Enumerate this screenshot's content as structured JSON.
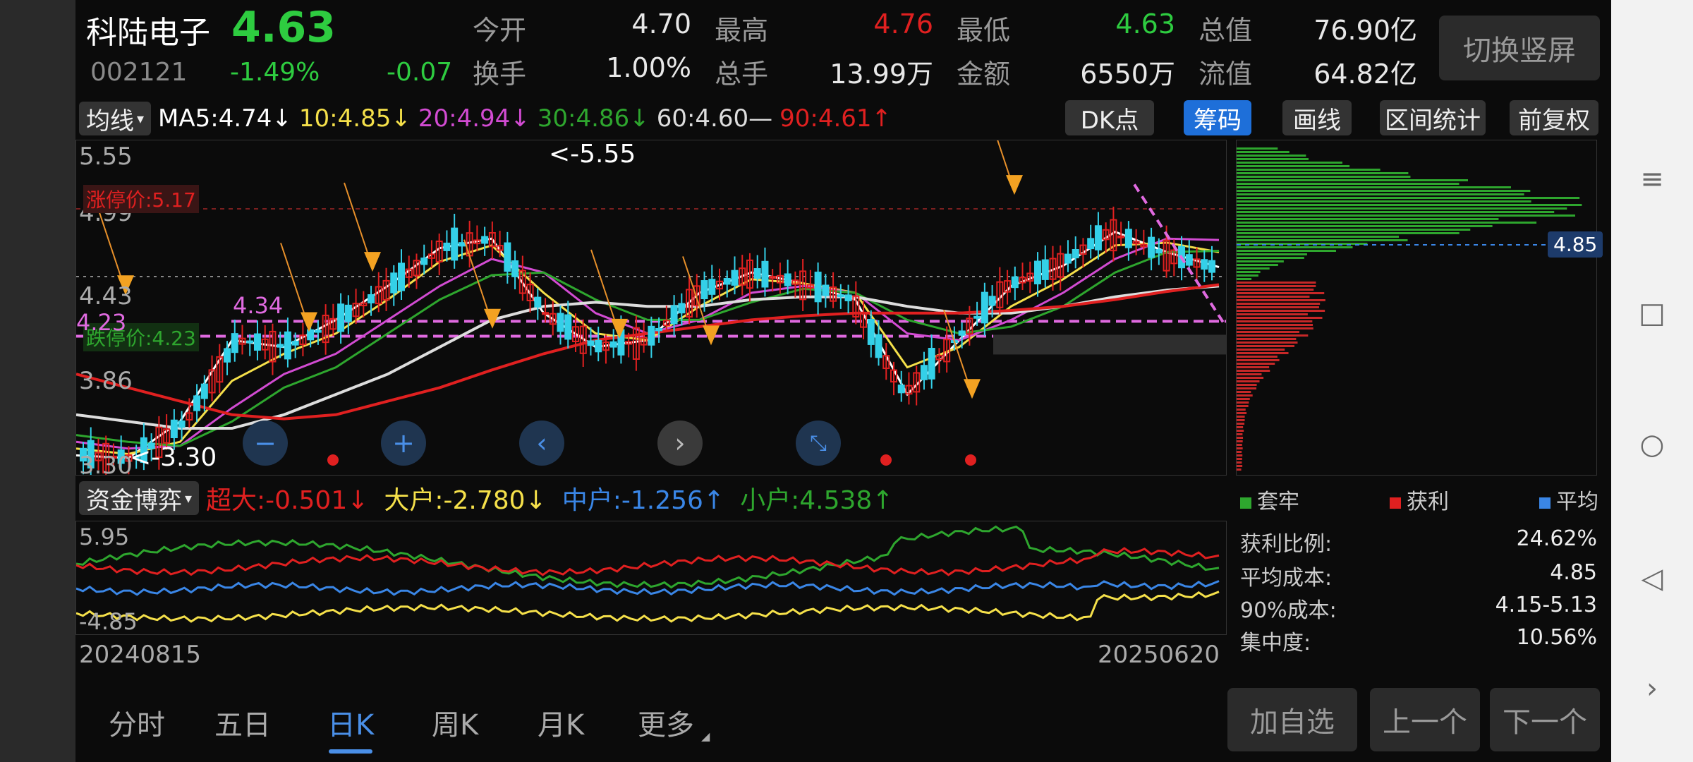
{
  "header": {
    "name": "科陆电子",
    "price": "4.63",
    "code": "002121",
    "pct": "-1.49%",
    "change": "-0.07",
    "quotes": [
      {
        "label": "今开",
        "value": "4.70",
        "color": "#e8e8e8"
      },
      {
        "label": "最高",
        "value": "4.76",
        "color": "#e02020"
      },
      {
        "label": "最低",
        "value": "4.63",
        "color": "#2ecc40"
      },
      {
        "label": "总值",
        "value": "76.90亿",
        "color": "#e8e8e8"
      },
      {
        "label": "换手",
        "value": "1.00%",
        "color": "#e8e8e8"
      },
      {
        "label": "总手",
        "value": "13.99万",
        "color": "#e8e8e8"
      },
      {
        "label": "金额",
        "value": "6550万",
        "color": "#e8e8e8"
      },
      {
        "label": "流值",
        "value": "64.82亿",
        "color": "#e8e8e8"
      }
    ],
    "switch_label": "切换竖屏"
  },
  "ma_bar": {
    "dropdown": "均线",
    "items": [
      {
        "text": "MA5:4.74↓",
        "color": "#ffffff"
      },
      {
        "text": "10:4.85↓",
        "color": "#f5e04a"
      },
      {
        "text": "20:4.94↓",
        "color": "#d24bd2"
      },
      {
        "text": "30:4.86↓",
        "color": "#2ea62e"
      },
      {
        "text": "60:4.60—",
        "color": "#dddddd"
      },
      {
        "text": "90:4.61↑",
        "color": "#e02020"
      }
    ],
    "buttons": [
      "DK点",
      "筹码",
      "画线",
      "区间统计",
      "前复权"
    ]
  },
  "kline": {
    "y_labels": [
      "5.55",
      "4.99",
      "4.43",
      "3.86",
      "3.30"
    ],
    "limit_up": "涨停价:5.17",
    "limit_down": "跌停价:4.23",
    "marker_high": "<-5.55",
    "marker_low": "<-3.30",
    "line_label_1": "4.34",
    "line_label_2": "4.23",
    "chip_price": "4.85"
  },
  "chart_data": {
    "type": "line",
    "title": "",
    "ylim": [
      3.3,
      5.55
    ],
    "x_range": [
      "20240815",
      "20250620"
    ],
    "series": [
      {
        "name": "MA5",
        "values": [
          3.35,
          3.33,
          3.6,
          4.2,
          4.15,
          4.35,
          4.6,
          4.88,
          4.95,
          4.4,
          4.15,
          4.2,
          4.55,
          4.7,
          4.62,
          4.5,
          3.8,
          4.2,
          4.6,
          4.75,
          5.0,
          4.85,
          4.74
        ]
      },
      {
        "name": "10",
        "values": [
          3.4,
          3.36,
          3.45,
          3.9,
          4.1,
          4.25,
          4.5,
          4.78,
          4.9,
          4.55,
          4.25,
          4.2,
          4.45,
          4.65,
          4.62,
          4.55,
          4.0,
          4.15,
          4.45,
          4.65,
          4.9,
          4.92,
          4.85
        ]
      },
      {
        "name": "20",
        "values": [
          3.45,
          3.4,
          3.42,
          3.7,
          3.95,
          4.1,
          4.35,
          4.6,
          4.8,
          4.7,
          4.4,
          4.25,
          4.35,
          4.55,
          4.6,
          4.55,
          4.25,
          4.2,
          4.35,
          4.55,
          4.8,
          4.95,
          4.94
        ]
      },
      {
        "name": "30",
        "values": [
          3.5,
          3.45,
          3.42,
          3.6,
          3.85,
          4.0,
          4.25,
          4.5,
          4.68,
          4.7,
          4.5,
          4.35,
          4.35,
          4.48,
          4.58,
          4.55,
          4.35,
          4.25,
          4.3,
          4.45,
          4.7,
          4.85,
          4.86
        ]
      },
      {
        "name": "60",
        "values": [
          3.65,
          3.6,
          3.55,
          3.55,
          3.65,
          3.8,
          3.95,
          4.15,
          4.35,
          4.45,
          4.48,
          4.45,
          4.45,
          4.5,
          4.52,
          4.52,
          4.45,
          4.4,
          4.4,
          4.45,
          4.52,
          4.57,
          4.6
        ]
      },
      {
        "name": "90",
        "values": [
          3.95,
          3.85,
          3.75,
          3.65,
          3.62,
          3.65,
          3.75,
          3.85,
          3.98,
          4.1,
          4.2,
          4.25,
          4.3,
          4.35,
          4.38,
          4.4,
          4.4,
          4.4,
          4.42,
          4.45,
          4.5,
          4.56,
          4.61
        ]
      }
    ]
  },
  "chip_dist": {
    "legend": [
      "套牢",
      "获利",
      "平均"
    ],
    "stats": [
      {
        "label": "获利比例:",
        "value": "24.62%"
      },
      {
        "label": "平均成本:",
        "value": "4.85"
      },
      {
        "label": "90%成本:",
        "value": "4.15-5.13"
      },
      {
        "label": "集中度:",
        "value": "10.56%"
      }
    ]
  },
  "fund_bar": {
    "dropdown": "资金博弈",
    "items": [
      {
        "text": "超大:-0.501↓",
        "color": "#e02020"
      },
      {
        "text": "大户:-2.780↓",
        "color": "#f5e04a"
      },
      {
        "text": "中户:-1.256↑",
        "color": "#3a86e6"
      },
      {
        "text": "小户:4.538↑",
        "color": "#2ea62e"
      }
    ],
    "y_top": "5.95",
    "y_bottom": "-4.85",
    "date_start": "20240815",
    "date_end": "20250620"
  },
  "bottom": {
    "tabs": [
      "分时",
      "五日",
      "日K",
      "周K",
      "月K",
      "更多"
    ],
    "buttons": [
      "加自选",
      "上一个",
      "下一个"
    ]
  }
}
